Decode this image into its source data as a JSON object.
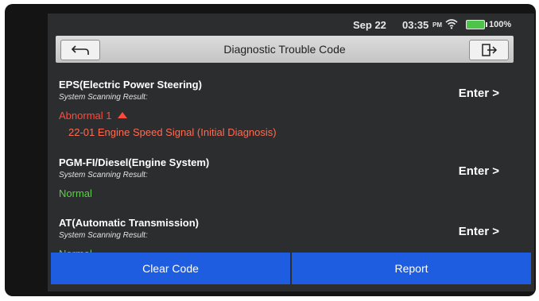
{
  "status_bar": {
    "date": "Sep 22",
    "time": "03:35",
    "ampm": "PM",
    "battery": "100%"
  },
  "header": {
    "title": "Diagnostic Trouble Code",
    "back_icon": "back-arrow-icon",
    "exit_icon": "exit-icon"
  },
  "systems": [
    {
      "name": "EPS(Electric Power Steering)",
      "subtitle": "System Scanning Result:",
      "status": "Abnormal 1",
      "dtc": "22-01 Engine Speed Signal (Initial Diagnosis)",
      "enter": "Enter >"
    },
    {
      "name": "PGM-FI/Diesel(Engine System)",
      "subtitle": "System Scanning Result:",
      "status": "Normal",
      "enter": "Enter >"
    },
    {
      "name": "AT(Automatic Transmission)",
      "subtitle": "System Scanning Result:",
      "status": "Normal",
      "enter": "Enter >"
    }
  ],
  "buttons": {
    "clear_code": "Clear Code",
    "report": "Report"
  },
  "colors": {
    "abnormal": "#ff4a3c",
    "normal": "#5cd046",
    "button_blue": "#1f5de0"
  }
}
